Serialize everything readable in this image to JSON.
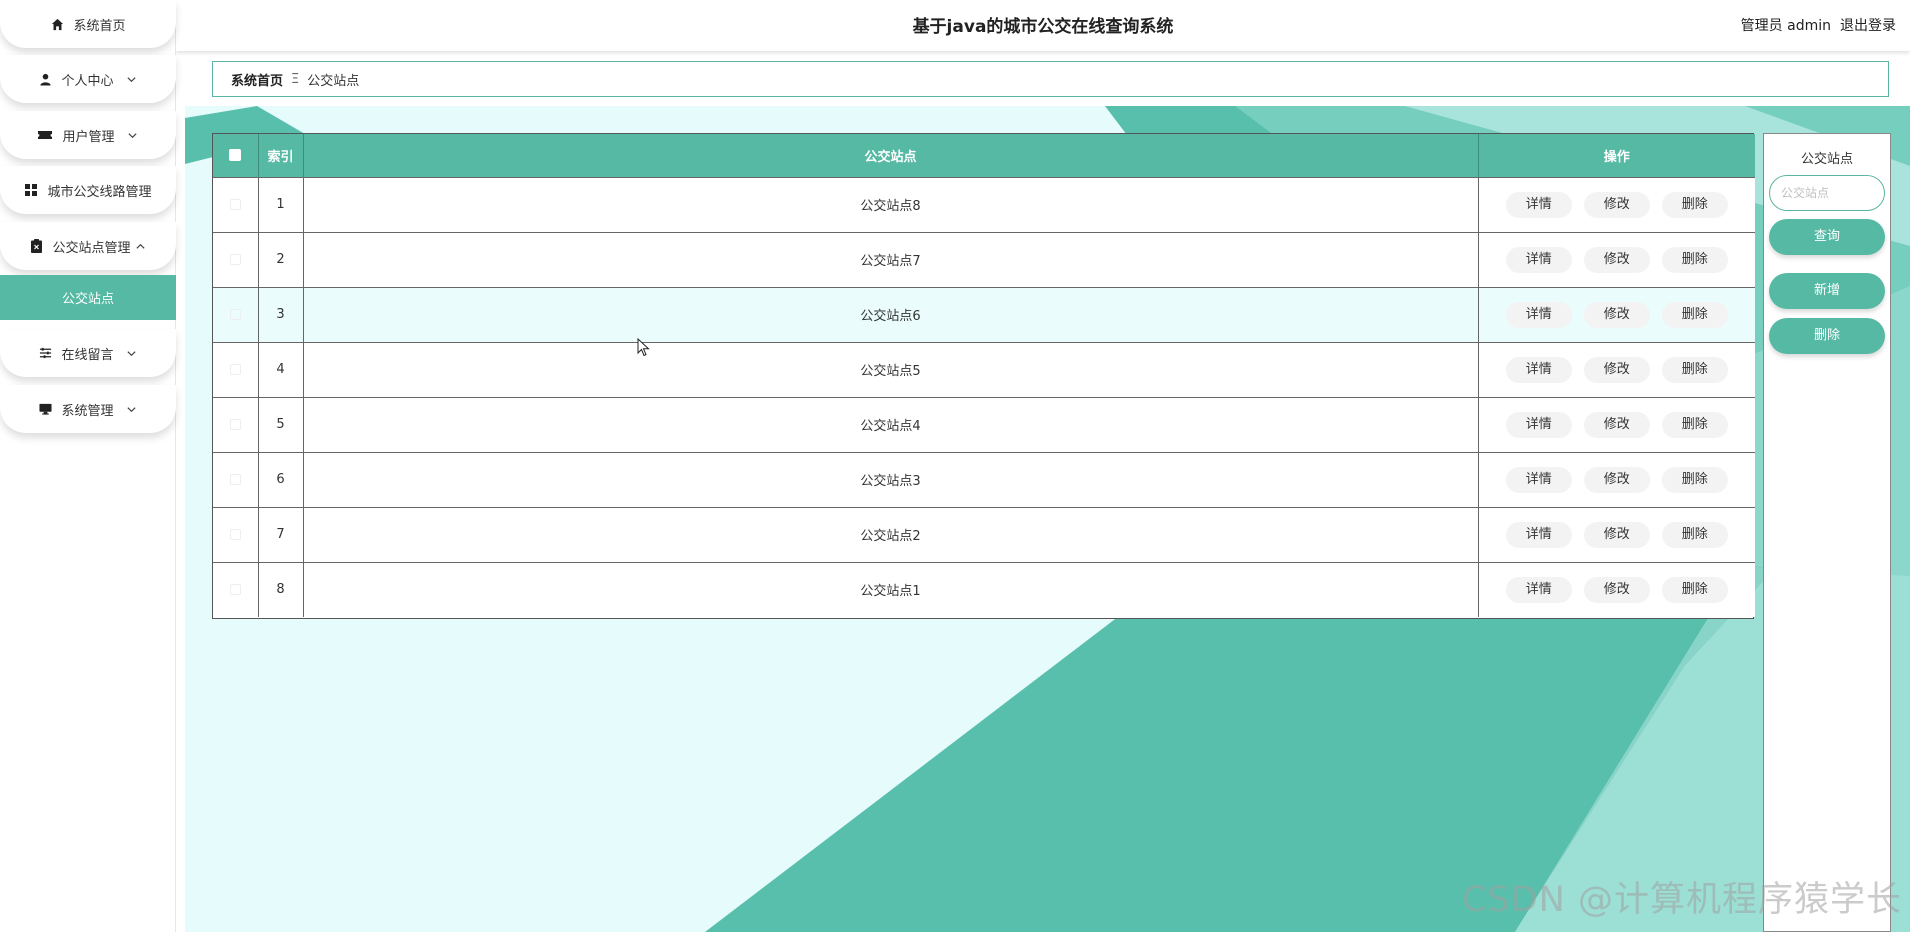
{
  "app": {
    "title": "基于java的城市公交在线查询系统",
    "user_label": "管理员 admin",
    "logout_label": "退出登录"
  },
  "sidebar": {
    "items": [
      {
        "label": "系统首页",
        "icon": "home-icon"
      },
      {
        "label": "个人中心",
        "icon": "user-icon"
      },
      {
        "label": "用户管理",
        "icon": "ticket-icon"
      },
      {
        "label": "城市公交线路管理",
        "icon": "grid-icon"
      },
      {
        "label": "公交站点管理",
        "icon": "clipboard-icon"
      },
      {
        "label": "在线留言",
        "icon": "sliders-icon"
      },
      {
        "label": "系统管理",
        "icon": "monitor-icon"
      }
    ],
    "active_sub": "公交站点"
  },
  "breadcrumb": {
    "home": "系统首页",
    "separator": "Ξ",
    "current": "公交站点"
  },
  "table": {
    "headers": {
      "index": "索引",
      "station": "公交站点",
      "ops": "操作"
    },
    "actions": {
      "detail": "详情",
      "edit": "修改",
      "delete": "删除"
    },
    "rows": [
      {
        "index": "1",
        "station": "公交站点8"
      },
      {
        "index": "2",
        "station": "公交站点7"
      },
      {
        "index": "3",
        "station": "公交站点6"
      },
      {
        "index": "4",
        "station": "公交站点5"
      },
      {
        "index": "5",
        "station": "公交站点4"
      },
      {
        "index": "6",
        "station": "公交站点3"
      },
      {
        "index": "7",
        "station": "公交站点2"
      },
      {
        "index": "8",
        "station": "公交站点1"
      }
    ]
  },
  "search": {
    "label": "公交站点",
    "placeholder": "公交站点",
    "value": "",
    "search_btn": "查询",
    "add_btn": "新增",
    "delete_btn": "删除"
  },
  "watermark": "CSDN @计算机程序猿学长",
  "colors": {
    "accent": "#55b9a4",
    "content_bg": "#e6fbfb",
    "border": "#5ab6a2"
  }
}
